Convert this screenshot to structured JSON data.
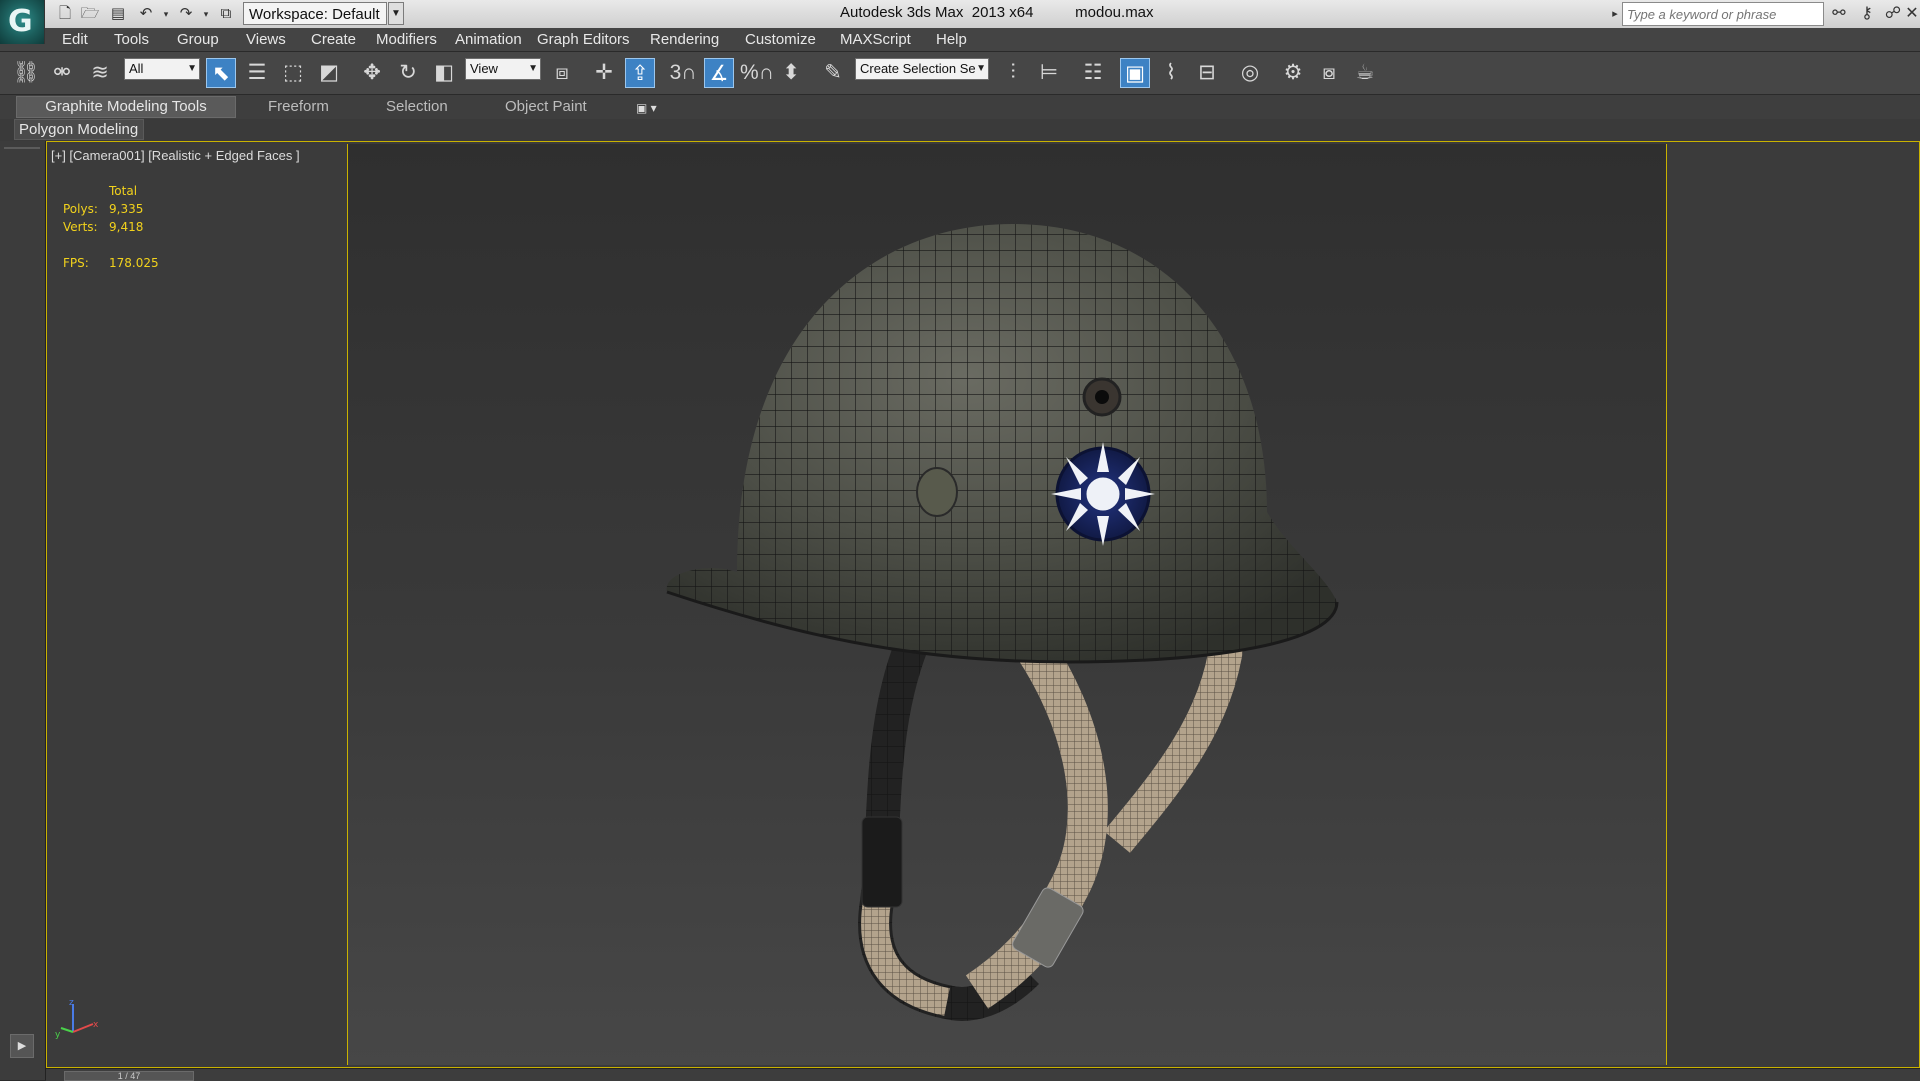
{
  "titlebar": {
    "workspace": "Workspace: Default",
    "app_title": "Autodesk 3ds Max  2013 x64",
    "file_name": "modou.max",
    "search_placeholder": "Type a keyword or phrase"
  },
  "menu": {
    "items": [
      "Edit",
      "Tools",
      "Group",
      "Views",
      "Create",
      "Modifiers",
      "Animation",
      "Graph Editors",
      "Rendering",
      "Customize",
      "MAXScript",
      "Help"
    ]
  },
  "toolbar": {
    "selection_filter": "All",
    "reference_coord": "View",
    "snap_label": "3",
    "percent_snap_label": "%",
    "named_selection": "Create Selection Se"
  },
  "ribbon": {
    "tabs": [
      "Graphite Modeling Tools",
      "Freeform",
      "Selection",
      "Object Paint"
    ],
    "panel_button": "Polygon Modeling"
  },
  "viewport": {
    "label": "[+] [Camera001] [Realistic + Edged Faces ]",
    "stats": {
      "total_label": "Total",
      "polys_label": "Polys:",
      "polys_value": "9,335",
      "verts_label": "Verts:",
      "verts_value": "9,418",
      "fps_label": "FPS:",
      "fps_value": "178.025"
    },
    "axis": {
      "x": "x",
      "y": "y",
      "z": "z"
    }
  },
  "timeline": {
    "frame": "1 / 47"
  },
  "colors": {
    "viewport_border": "#c9b200",
    "stats_text": "#f2d21c",
    "active_tool": "#3d82c4"
  }
}
